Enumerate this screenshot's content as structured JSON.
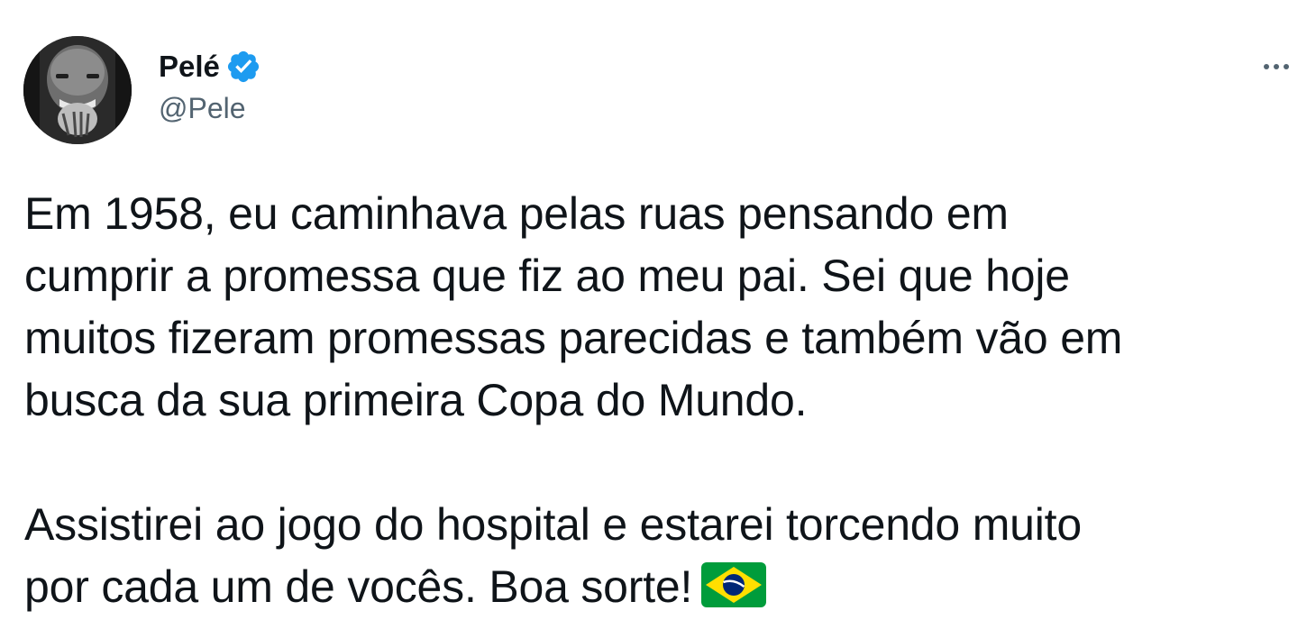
{
  "author": {
    "display_name": "Pelé",
    "handle": "@Pele",
    "verified": true
  },
  "icons": {
    "verified": "verified-badge-icon",
    "more": "more-horizontal-icon",
    "flag": "brazil-flag-emoji"
  },
  "tweet": {
    "paragraph1_lines": [
      "Em 1958, eu caminhava pelas ruas pensando em",
      "cumprir a promessa que fiz ao meu pai. Sei que hoje",
      "muitos fizeram promessas parecidas e também vão em",
      "busca da sua primeira Copa do Mundo."
    ],
    "paragraph2_lines": [
      "Assistirei ao jogo do hospital e estarei torcendo muito",
      "por cada um de vocês. Boa sorte!"
    ]
  },
  "colors": {
    "text": "#0f1419",
    "secondary": "#536471",
    "verified_blue": "#1d9bf0",
    "background": "#ffffff"
  }
}
